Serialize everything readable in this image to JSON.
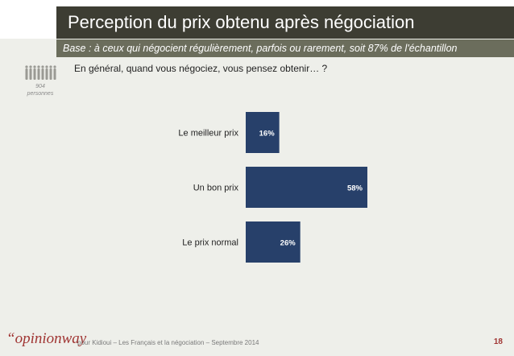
{
  "header": {
    "title": "Perception du prix obtenu après négociation",
    "subtitle": "Base : à ceux qui négocient régulièrement, parfois ou rarement, soit 87% de l'échantillon"
  },
  "sample": {
    "count": "904",
    "unit": "personnes",
    "icon": "people-group-icon"
  },
  "question": "En général, quand vous négociez, vous pensez obtenir… ?",
  "chart_data": {
    "type": "bar",
    "orientation": "horizontal",
    "categories": [
      "Le meilleur prix",
      "Un bon prix",
      "Le prix normal"
    ],
    "values": [
      16,
      58,
      26
    ],
    "value_labels": [
      "16%",
      "58%",
      "26%"
    ],
    "unit": "%",
    "xlim": [
      0,
      58
    ],
    "grid": false,
    "bar_color": "#27406a"
  },
  "footer": {
    "logo": "“opinionway",
    "text": "pour Kidioui – Les Français et la négociation – Septembre 2014",
    "page": "18"
  },
  "colors": {
    "title_bg": "#3d3d33",
    "subtitle_bg": "#6b6d5c",
    "accent": "#a03533",
    "background": "#eeefea"
  }
}
